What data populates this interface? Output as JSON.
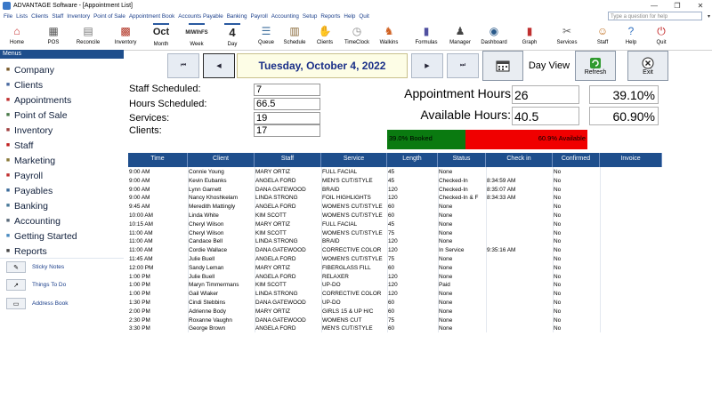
{
  "window": {
    "title": "ADVANTAGE Software - [Appointment List]",
    "controls": [
      "—",
      "❐",
      "✕"
    ]
  },
  "menubar": [
    "File",
    "Lists",
    "Clients",
    "Staff",
    "Inventory",
    "Point of Sale",
    "Appointment Book",
    "Accounts Payable",
    "Banking",
    "Payroll",
    "Accounting",
    "Setup",
    "Reports",
    "Help",
    "Quit"
  ],
  "help_box": {
    "placeholder": "Type a question for help"
  },
  "toolbar": [
    {
      "label": "Home",
      "icon": "house-icon"
    },
    {
      "label": "POS",
      "icon": "cash-register-icon"
    },
    {
      "label": "Reconcile",
      "icon": "calculator-icon"
    },
    {
      "label": "Inventory",
      "icon": "box-icon"
    },
    {
      "label": "Month",
      "icon": "month-calendar-icon",
      "text": "Oct"
    },
    {
      "label": "Week",
      "icon": "week-calendar-icon",
      "text": "MIWIhFS"
    },
    {
      "label": "Day",
      "icon": "day-calendar-icon",
      "text": "4"
    },
    {
      "label": "Queue",
      "icon": "queue-icon"
    },
    {
      "label": "Schedule",
      "icon": "schedule-icon"
    },
    {
      "label": "Clients",
      "icon": "handshake-icon"
    },
    {
      "label": "TimeClock",
      "icon": "clock-icon"
    },
    {
      "label": "Walkins",
      "icon": "walking-person-icon"
    },
    {
      "label": "Formulas",
      "icon": "formula-book-icon"
    },
    {
      "label": "Manager",
      "icon": "manager-icon"
    },
    {
      "label": "Dashboard",
      "icon": "gauge-icon"
    },
    {
      "label": "Graph",
      "icon": "bar-graph-icon"
    },
    {
      "label": "Services",
      "icon": "scissors-icon"
    },
    {
      "label": "Staff",
      "icon": "staff-icon"
    },
    {
      "label": "Help",
      "icon": "help-icon"
    },
    {
      "label": "Quit",
      "icon": "quit-icon"
    }
  ],
  "sidebar": {
    "header": "Menus",
    "items": [
      {
        "label": "Company",
        "icon": "company-icon"
      },
      {
        "label": "Clients",
        "icon": "clients-icon"
      },
      {
        "label": "Appointments",
        "icon": "appointments-icon"
      },
      {
        "label": "Point of Sale",
        "icon": "point-of-sale-icon"
      },
      {
        "label": "Inventory",
        "icon": "inventory-icon"
      },
      {
        "label": "Staff",
        "icon": "staff-icon"
      },
      {
        "label": "Marketing",
        "icon": "marketing-icon"
      },
      {
        "label": "Payroll",
        "icon": "payroll-icon"
      },
      {
        "label": "Payables",
        "icon": "payables-icon"
      },
      {
        "label": "Banking",
        "icon": "banking-icon"
      },
      {
        "label": "Accounting",
        "icon": "accounting-icon"
      },
      {
        "label": "Getting Started",
        "icon": "getting-started-icon"
      },
      {
        "label": "Reports",
        "icon": "reports-icon"
      }
    ],
    "tools": [
      {
        "label": "Sticky Notes",
        "icon": "sticky-notes-icon"
      },
      {
        "label": "Things To Do",
        "icon": "arrow-icon"
      },
      {
        "label": "Address Book",
        "icon": "address-book-icon"
      }
    ]
  },
  "nav": {
    "date": "Tuesday, October 4, 2022",
    "first": "⏮",
    "prev": "◀",
    "next": "▶",
    "last": "⏭",
    "day_view": "Day View",
    "refresh": "Refresh",
    "exit": "Exit"
  },
  "stats": {
    "staff_scheduled_label": "Staff Scheduled:",
    "staff_scheduled": "7",
    "hours_scheduled_label": "Hours Scheduled:",
    "hours_scheduled": "66.5",
    "services_label": "Services:",
    "services": "19",
    "clients_label": "Clients:",
    "clients": "17",
    "appt_hours_label": "Appointment Hours",
    "appt_hours": "26",
    "appt_pct": "39.10%",
    "avail_hours_label": "Available Hours:",
    "avail_hours": "40.5",
    "avail_pct": "60.90%",
    "booked_text": "39.0% Booked",
    "available_text": "60.9% Available",
    "booked_fraction": 0.39,
    "colors": {
      "booked": "#0a7a10",
      "available": "#f00000",
      "header": "#1e4e8c"
    }
  },
  "grid": {
    "columns": [
      "Time",
      "Client",
      "Staff",
      "Service",
      "Length",
      "Status",
      "Check in",
      "Confirmed",
      "Invoice"
    ],
    "rows": [
      [
        "9:00 AM",
        "Connie Young",
        "MARY ORTIZ",
        "FULL FACIAL",
        "45",
        "None",
        "",
        "No",
        ""
      ],
      [
        "9:00 AM",
        "Kevin Eubanks",
        "ANGELA FORD",
        "MEN'S CUT/STYLE",
        "45",
        "Checked-In",
        "8:34:59 AM",
        "No",
        ""
      ],
      [
        "9:00 AM",
        "Lynn Garnett",
        "DANA GATEWOOD",
        "BRAID",
        "120",
        "Checked-In",
        "8:35:07 AM",
        "No",
        ""
      ],
      [
        "9:00 AM",
        "Nancy Khoshkelam",
        "LINDA STRONG",
        "FOIL HIGHLIGHTS",
        "120",
        "Checked-In & F",
        "8:34:33 AM",
        "No",
        ""
      ],
      [
        "9:45 AM",
        "Meredith Mattingly",
        "ANGELA FORD",
        "WOMEN'S CUT/STYLE",
        "60",
        "None",
        "",
        "No",
        ""
      ],
      [
        "10:00 AM",
        "Linda White",
        "KIM SCOTT",
        "WOMEN'S CUT/STYLE",
        "60",
        "None",
        "",
        "No",
        ""
      ],
      [
        "10:15 AM",
        "Cheryl Wilson",
        "MARY ORTIZ",
        "FULL FACIAL",
        "45",
        "None",
        "",
        "No",
        ""
      ],
      [
        "11:00 AM",
        "Cheryl Wilson",
        "KIM SCOTT",
        "WOMEN'S CUT/STYLE",
        "75",
        "None",
        "",
        "No",
        ""
      ],
      [
        "11:00 AM",
        "Candace Bell",
        "LINDA STRONG",
        "BRAID",
        "120",
        "None",
        "",
        "No",
        ""
      ],
      [
        "11:00 AM",
        "Cordie Wallace",
        "DANA GATEWOOD",
        "CORRECTIVE COLOR",
        "120",
        "In Service",
        "9:35:16 AM",
        "No",
        ""
      ],
      [
        "11:45 AM",
        "Julie Buell",
        "ANGELA FORD",
        "WOMEN'S CUT/STYLE",
        "75",
        "None",
        "",
        "No",
        ""
      ],
      [
        "12:00 PM",
        "Sandy Leman",
        "MARY ORTIZ",
        "FIBERGLASS FILL",
        "60",
        "None",
        "",
        "No",
        ""
      ],
      [
        "1:00 PM",
        "Julie Buell",
        "ANGELA FORD",
        "RELAXER",
        "120",
        "None",
        "",
        "No",
        ""
      ],
      [
        "1:00 PM",
        "Maryn Timmermans",
        "KIM SCOTT",
        "UP-DO",
        "120",
        "Paid",
        "",
        "No",
        ""
      ],
      [
        "1:00 PM",
        "Gail Wlaker",
        "LINDA STRONG",
        "CORRECTIVE COLOR",
        "120",
        "None",
        "",
        "No",
        ""
      ],
      [
        "1:30 PM",
        "Cindi Stebbins",
        "DANA GATEWOOD",
        "UP-DO",
        "60",
        "None",
        "",
        "No",
        ""
      ],
      [
        "2:00 PM",
        "Adrienne Body",
        "MARY ORTIZ",
        "GIRLS 15 &  UP H/C",
        "60",
        "None",
        "",
        "No",
        ""
      ],
      [
        "2:30 PM",
        "Roxanne Vaughn",
        "DANA GATEWOOD",
        "WOMENS CUT",
        "75",
        "None",
        "",
        "No",
        ""
      ],
      [
        "3:30 PM",
        "George Brown",
        "ANGELA FORD",
        "MEN'S CUT/STYLE",
        "60",
        "None",
        "",
        "No",
        ""
      ]
    ]
  }
}
